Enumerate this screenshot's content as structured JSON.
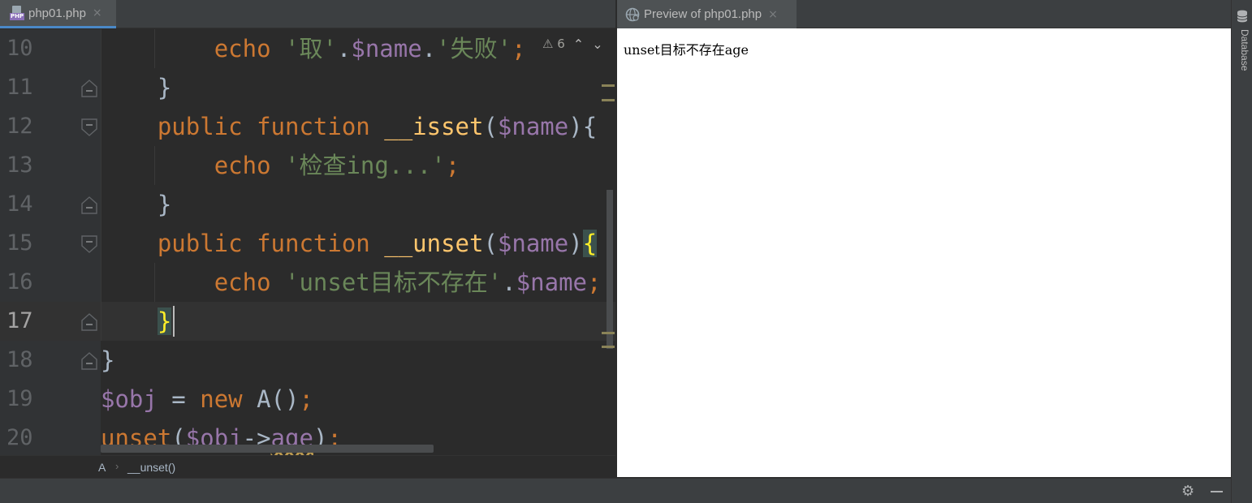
{
  "editor": {
    "tab": {
      "label": "php01.php",
      "close": "×",
      "icon_badge": "PHP"
    },
    "inspection": {
      "warning_icon": "⚠",
      "count": "6",
      "prev": "⌃",
      "next": "⌄"
    },
    "lines": [
      {
        "num": "10",
        "indent": "        ",
        "tokens": [
          {
            "t": "echo",
            "c": "kw"
          },
          {
            "t": " ",
            "c": "plain"
          },
          {
            "t": "'取'",
            "c": "str"
          },
          {
            "t": ".",
            "c": "plain"
          },
          {
            "t": "$name",
            "c": "var"
          },
          {
            "t": ".",
            "c": "plain"
          },
          {
            "t": "'失败'",
            "c": "str"
          },
          {
            "t": ";",
            "c": "punc"
          }
        ]
      },
      {
        "num": "11",
        "indent": "    ",
        "tokens": [
          {
            "t": "}",
            "c": "plain"
          }
        ]
      },
      {
        "num": "12",
        "indent": "    ",
        "tokens": [
          {
            "t": "public",
            "c": "kw"
          },
          {
            "t": " ",
            "c": "plain"
          },
          {
            "t": "function",
            "c": "kw"
          },
          {
            "t": " ",
            "c": "plain"
          },
          {
            "t": "__isset",
            "c": "fn"
          },
          {
            "t": "(",
            "c": "plain"
          },
          {
            "t": "$name",
            "c": "var"
          },
          {
            "t": "){",
            "c": "plain"
          }
        ]
      },
      {
        "num": "13",
        "indent": "        ",
        "tokens": [
          {
            "t": "echo",
            "c": "kw"
          },
          {
            "t": " ",
            "c": "plain"
          },
          {
            "t": "'检查ing...'",
            "c": "str"
          },
          {
            "t": ";",
            "c": "punc"
          }
        ]
      },
      {
        "num": "14",
        "indent": "    ",
        "tokens": [
          {
            "t": "}",
            "c": "plain"
          }
        ]
      },
      {
        "num": "15",
        "indent": "    ",
        "tokens": [
          {
            "t": "public",
            "c": "kw"
          },
          {
            "t": " ",
            "c": "plain"
          },
          {
            "t": "function",
            "c": "kw"
          },
          {
            "t": " ",
            "c": "plain"
          },
          {
            "t": "__unset",
            "c": "fn"
          },
          {
            "t": "(",
            "c": "plain"
          },
          {
            "t": "$name",
            "c": "var"
          },
          {
            "t": ")",
            "c": "plain"
          },
          {
            "t": "{",
            "c": "brace"
          }
        ]
      },
      {
        "num": "16",
        "indent": "        ",
        "tokens": [
          {
            "t": "echo",
            "c": "kw"
          },
          {
            "t": " ",
            "c": "plain"
          },
          {
            "t": "'unset目标不存在'",
            "c": "str"
          },
          {
            "t": ".",
            "c": "plain"
          },
          {
            "t": "$name",
            "c": "var"
          },
          {
            "t": ";",
            "c": "punc"
          }
        ]
      },
      {
        "num": "17",
        "indent": "    ",
        "current": true,
        "tokens": [
          {
            "t": "}",
            "c": "brace"
          }
        ]
      },
      {
        "num": "18",
        "indent": "",
        "tokens": [
          {
            "t": "}",
            "c": "plain"
          }
        ]
      },
      {
        "num": "19",
        "indent": "",
        "tokens": [
          {
            "t": "$obj",
            "c": "var"
          },
          {
            "t": " = ",
            "c": "plain"
          },
          {
            "t": "new",
            "c": "kw"
          },
          {
            "t": " A()",
            "c": "plain"
          },
          {
            "t": ";",
            "c": "punc"
          }
        ]
      },
      {
        "num": "20",
        "indent": "",
        "tokens": [
          {
            "t": "unset",
            "c": "kw"
          },
          {
            "t": "(",
            "c": "plain"
          },
          {
            "t": "$obj",
            "c": "var"
          },
          {
            "t": "->",
            "c": "plain"
          },
          {
            "t": "age",
            "c": "var-wavy"
          },
          {
            "t": ")",
            "c": "plain"
          },
          {
            "t": ";",
            "c": "punc"
          }
        ]
      }
    ],
    "breadcrumb": {
      "class": "A",
      "separator": "›",
      "method": "__unset()"
    }
  },
  "preview": {
    "tab": {
      "label": "Preview of php01.php",
      "close": "×"
    },
    "output_text": "unset目标不存在age"
  },
  "tool_strip": {
    "database_label": "Database"
  },
  "status_bar": {
    "settings_icon": "⚙"
  },
  "colors": {
    "keyword": "#cc7832",
    "function": "#ffc66d",
    "variable": "#9876aa",
    "string": "#6a8759",
    "plain": "#a9b7c6",
    "brace_highlight": "#ffef28",
    "tab_underline": "#4a88c7"
  }
}
